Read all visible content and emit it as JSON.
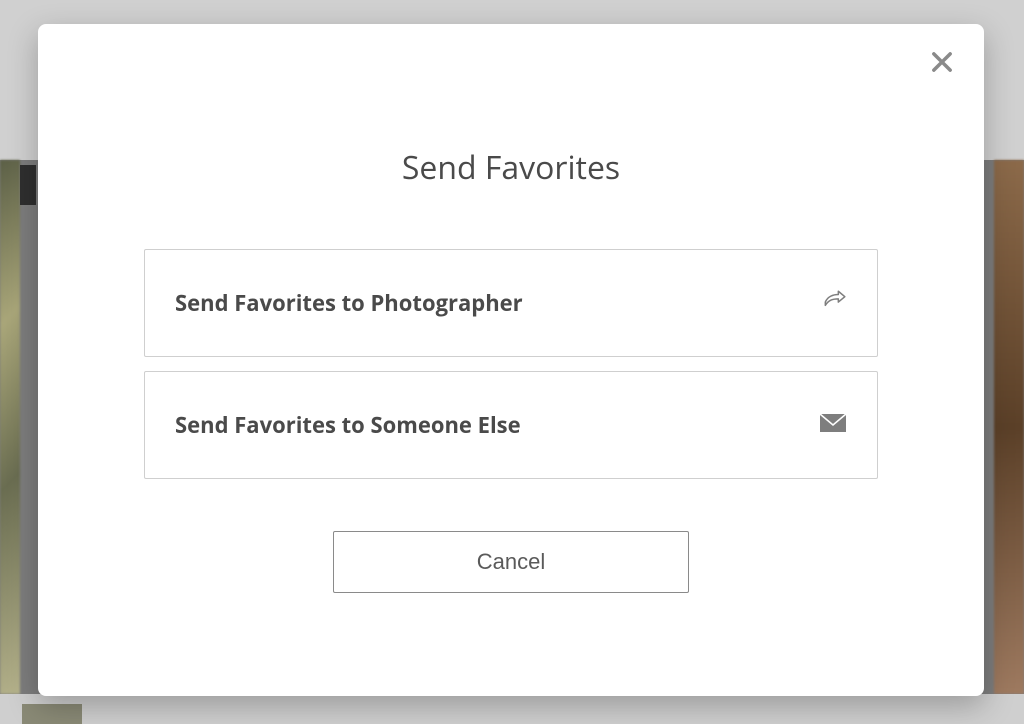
{
  "modal": {
    "title": "Send Favorites",
    "options": [
      {
        "label": "Send Favorites to Photographer"
      },
      {
        "label": "Send Favorites to Someone Else"
      }
    ],
    "cancel_label": "Cancel"
  }
}
